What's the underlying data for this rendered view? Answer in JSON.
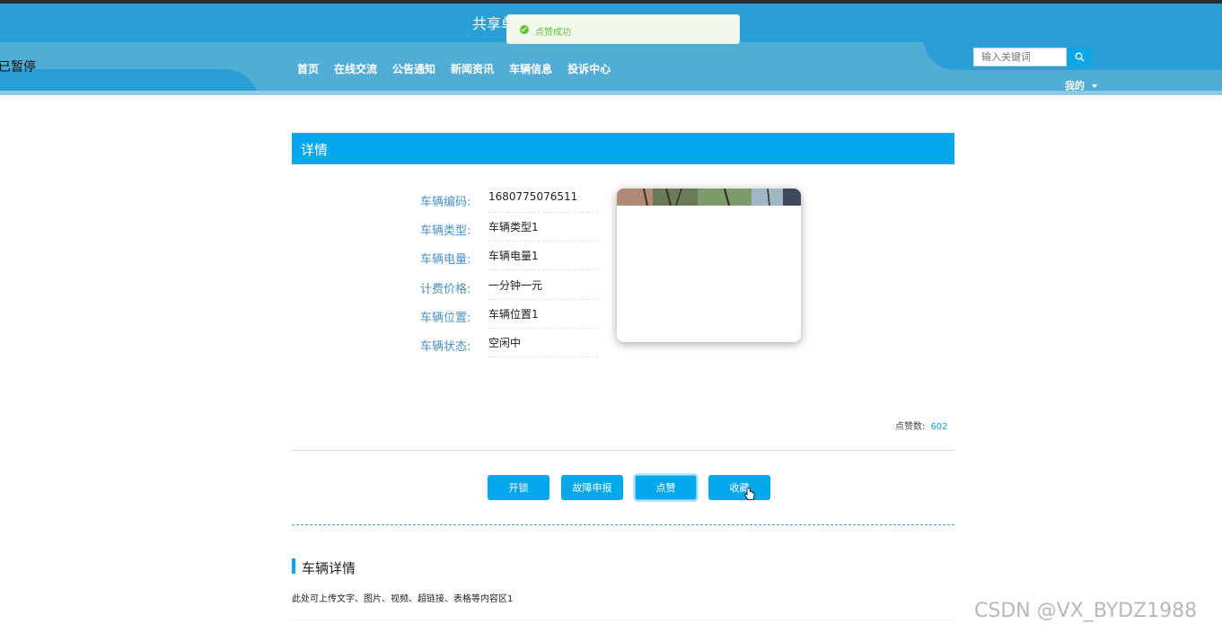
{
  "header": {
    "paused_label": "已暂停",
    "site_title": "共享单",
    "nav": [
      "首页",
      "在线交流",
      "公告通知",
      "新闻资讯",
      "车辆信息",
      "投诉中心"
    ],
    "search_placeholder": "输入关键词",
    "my_menu": "我的"
  },
  "toast": {
    "message": "点赞成功",
    "icon": "check-circle-icon",
    "color": "#67c23a"
  },
  "detail": {
    "title": "详情",
    "fields": [
      {
        "label": "车辆编码:",
        "value": "1680775076511"
      },
      {
        "label": "车辆类型:",
        "value": "车辆类型1"
      },
      {
        "label": "车辆电量:",
        "value": "车辆电量1"
      },
      {
        "label": "计费价格:",
        "value": "一分钟一元"
      },
      {
        "label": "车辆位置:",
        "value": "车辆位置1"
      },
      {
        "label": "车辆状态:",
        "value": "空闲中"
      }
    ],
    "likes_label": "点赞数:",
    "likes_count": "602"
  },
  "actions": [
    "开锁",
    "故障申报",
    "点赞",
    "收藏"
  ],
  "section": {
    "title": "车辆详情",
    "content": "此处可上传文字、图片、视频、超链接、表格等内容区1"
  },
  "watermark": "CSDN @VX_BYDZ1988",
  "colors": {
    "accent": "#03a8ec",
    "header": "#2a9fd6",
    "nav_band": "#52add6"
  }
}
